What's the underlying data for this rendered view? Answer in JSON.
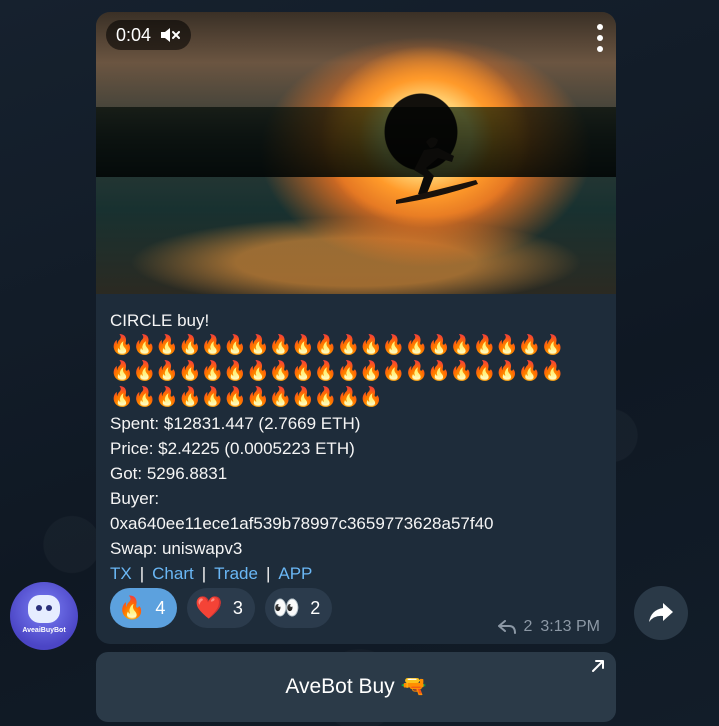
{
  "video": {
    "time": "0:04",
    "muted_icon": "speaker-muted-icon",
    "menu_icon": "more-vertical-icon"
  },
  "message": {
    "title": "CIRCLE buy!",
    "fire_rows": [
      "🔥🔥🔥🔥🔥🔥🔥🔥🔥🔥🔥🔥🔥🔥🔥🔥🔥🔥🔥🔥",
      "🔥🔥🔥🔥🔥🔥🔥🔥🔥🔥🔥🔥🔥🔥🔥🔥🔥🔥🔥🔥",
      "🔥🔥🔥🔥🔥🔥🔥🔥🔥🔥🔥🔥"
    ],
    "spent": "Spent: $12831.447 (2.7669 ETH)",
    "price": "Price: $2.4225 (0.0005223 ETH)",
    "got": "Got: 5296.8831",
    "buyer_label": "Buyer:",
    "buyer_address": "0xa640ee11ece1af539b78997c3659773628a57f40",
    "swap": "Swap: uniswapv3",
    "links": [
      "TX",
      "Chart",
      "Trade",
      "APP"
    ],
    "link_separator": "|"
  },
  "reactions": [
    {
      "emoji": "🔥",
      "count": "4",
      "active": true
    },
    {
      "emoji": "❤️",
      "count": "3",
      "active": false
    },
    {
      "emoji": "👀",
      "count": "2",
      "active": false
    }
  ],
  "meta": {
    "replies": "2",
    "time": "3:13 PM",
    "reply_icon": "reply-arrow-icon"
  },
  "sender": {
    "avatar_label": "AveaiBuyBot"
  },
  "inline_button": {
    "label": "AveBot Buy 🔫",
    "icon": "external-link-arrow-icon"
  },
  "colors": {
    "bubble": "#1e2c3a",
    "link": "#6ab7f5",
    "active_reaction": "#5ca1de",
    "background": "#0e1621"
  }
}
